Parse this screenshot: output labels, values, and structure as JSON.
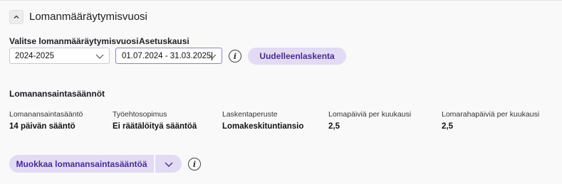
{
  "section": {
    "title": "Lomanmääräytymisvuosi"
  },
  "filters": {
    "year_label": "Valitse lomanmääräytymisvuosi",
    "year_value": "2024-2025",
    "period_label": "Asetuskausi",
    "period_value": "01.07.2024 - 31.03.2025",
    "recalc_label": "Uudelleenlaskenta"
  },
  "rules": {
    "title": "Lomanansaintasäännöt",
    "columns": [
      {
        "label": "Lomanansaintasääntö",
        "value": "14 päivän sääntö"
      },
      {
        "label": "Työehtosopimus",
        "value": "Ei räätälöityä sääntöä"
      },
      {
        "label": "Laskentaperuste",
        "value": "Lomakeskituntiansio"
      },
      {
        "label": "Lomapäiviä per kuukausi",
        "value": "2,5"
      },
      {
        "label": "Lomarahapäiviä per kuukausi",
        "value": "2,5"
      }
    ],
    "edit_label": "Muokkaa lomanansaintasääntöä"
  },
  "colors": {
    "accent_bg": "#e2dbf3",
    "accent_text": "#4a2c93"
  }
}
